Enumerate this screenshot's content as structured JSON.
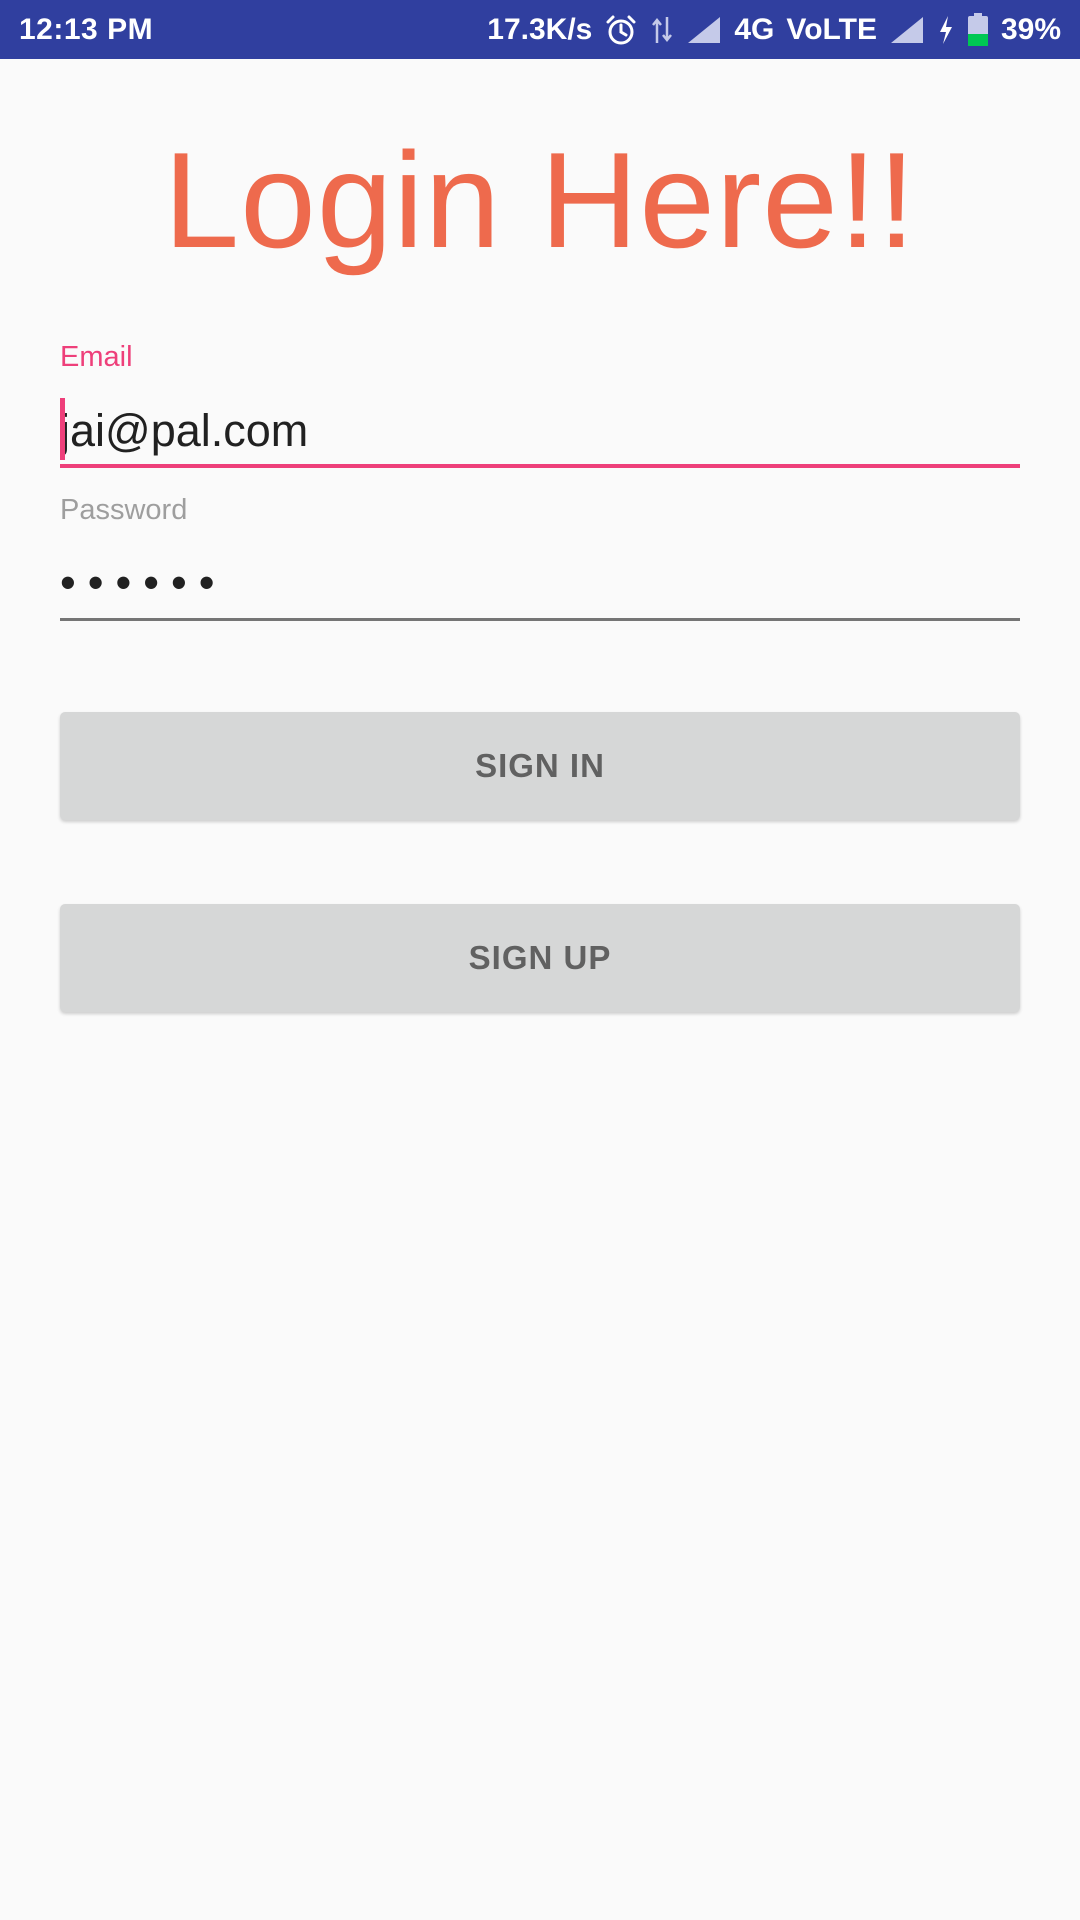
{
  "status_bar": {
    "time": "12:13 PM",
    "network_speed": "17.3K/s",
    "network_type": "4G",
    "volte": "VoLTE",
    "battery": "39%",
    "icons": [
      "alarm-icon",
      "data-arrows-icon",
      "signal-icon",
      "signal-icon",
      "charging-icon",
      "battery-icon"
    ],
    "bg_color": "#303f9f",
    "battery_fill_color": "#00c853",
    "battery_level_fraction": 0.39
  },
  "login": {
    "title": "Login Here!!",
    "title_color": "#ee6a4d",
    "accent_color": "#ee3f7a",
    "email": {
      "label": "Email",
      "value": "jai@pal.com"
    },
    "password": {
      "label": "Password",
      "value": "••••••"
    },
    "sign_in_label": "SIGN IN",
    "sign_up_label": "SIGN UP"
  }
}
